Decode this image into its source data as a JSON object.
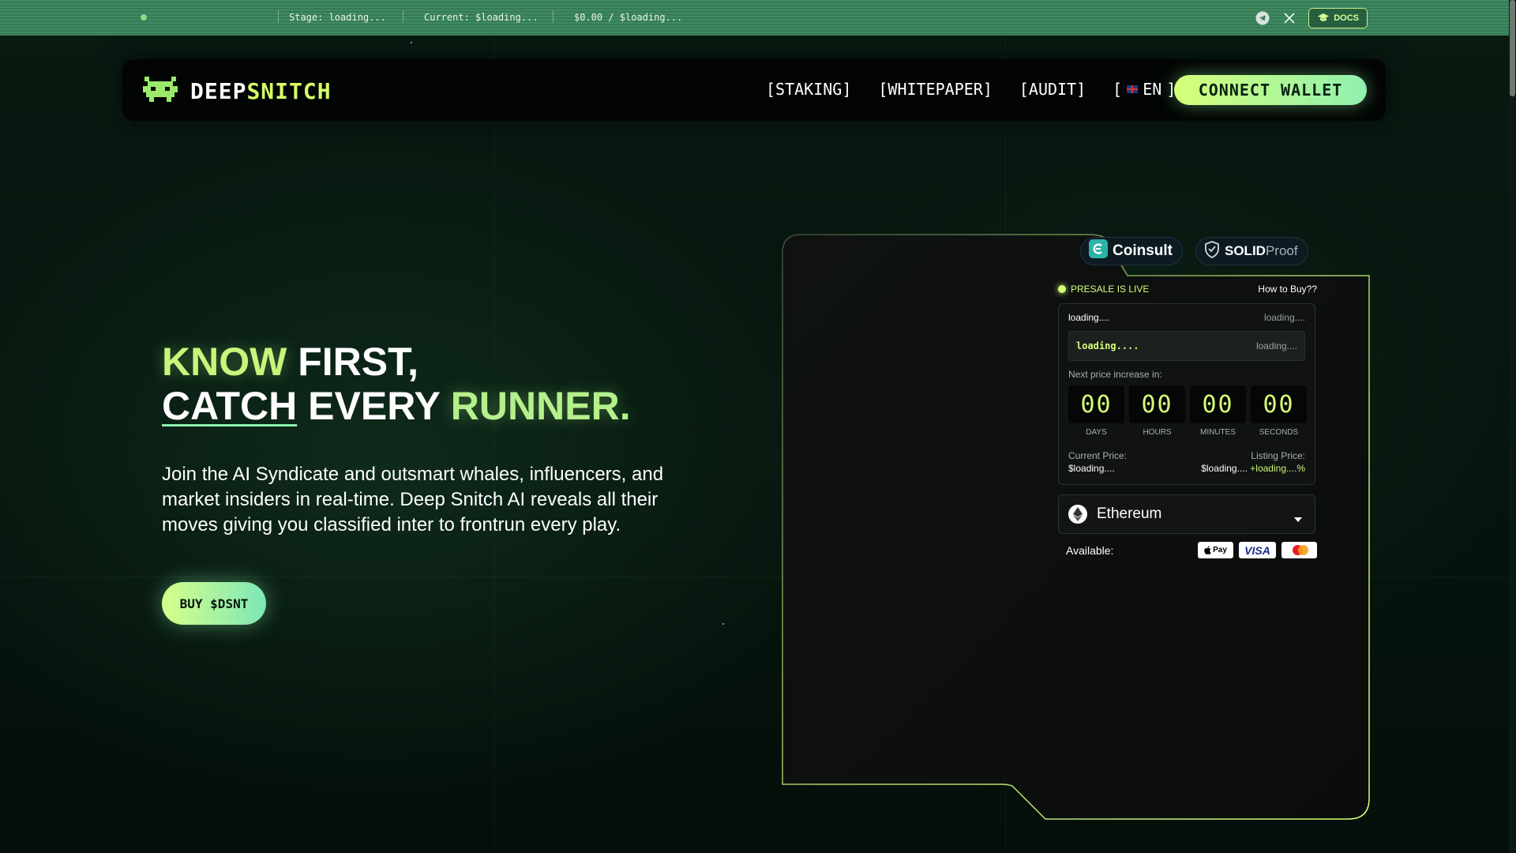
{
  "ticker": {
    "stage": "Stage: loading...",
    "current": "Current: $loading...",
    "raised": "$0.00 / $loading...",
    "docs_label": "DOCS"
  },
  "icons": {
    "telegram": "telegram-icon",
    "x": "x-icon",
    "docs": "graduation-cap-icon",
    "logo": "pixel-creature-icon",
    "chevron": "chevron-down-icon",
    "ethereum": "ethereum-icon",
    "caret": "caret-down-icon"
  },
  "nav": {
    "logo_part1": "DEEP",
    "logo_part2": "SNITCH",
    "staking": "[STAKING]",
    "whitepaper": "[WHITEPAPER]",
    "audit": "[AUDIT]",
    "lang_open": "[",
    "lang": "EN",
    "lang_close": "]",
    "connect": "CONNECT WALLET"
  },
  "hero": {
    "title_know": "KNOW",
    "title_first": " FIRST,",
    "title_catch": "CATCH",
    "title_every": " EVERY ",
    "title_runner": "RUNNER.",
    "description": "Join the AI Syndicate and outsmart whales, influencers, and market insiders in real-time. Deep Snitch AI reveals all their moves giving you classified inter to frontrun every play.",
    "buy_button": "BUY $DSNT"
  },
  "badges": {
    "coinsult": "Coinsult",
    "solid": "SOLID",
    "proof": "Proof"
  },
  "widget": {
    "presale_status": "PRESALE IS LIVE",
    "how_to_buy": "How to Buy??",
    "row1_left": "loading....",
    "row1_right": "loading....",
    "progress_left": "loading....",
    "progress_right": "loading....",
    "next_increase": "Next price increase in:",
    "countdown": [
      {
        "value": "00",
        "label": "DAYS"
      },
      {
        "value": "00",
        "label": "HOURS"
      },
      {
        "value": "00",
        "label": "MINUTES"
      },
      {
        "value": "00",
        "label": "SECONDS"
      }
    ],
    "current_price_label": "Current Price:",
    "current_price_value": "$loading....",
    "listing_price_label": "Listing Price:",
    "listing_price_value": "$loading....",
    "listing_price_pct": "+loading....%",
    "token": "Ethereum",
    "available_label": "Available:",
    "pay_apple": "Pay",
    "pay_visa": "VISA"
  },
  "colors": {
    "accent": "#d6ff7a",
    "accent2": "#8ff0b0",
    "background": "#06120c",
    "ticker": "#3f8a61"
  }
}
